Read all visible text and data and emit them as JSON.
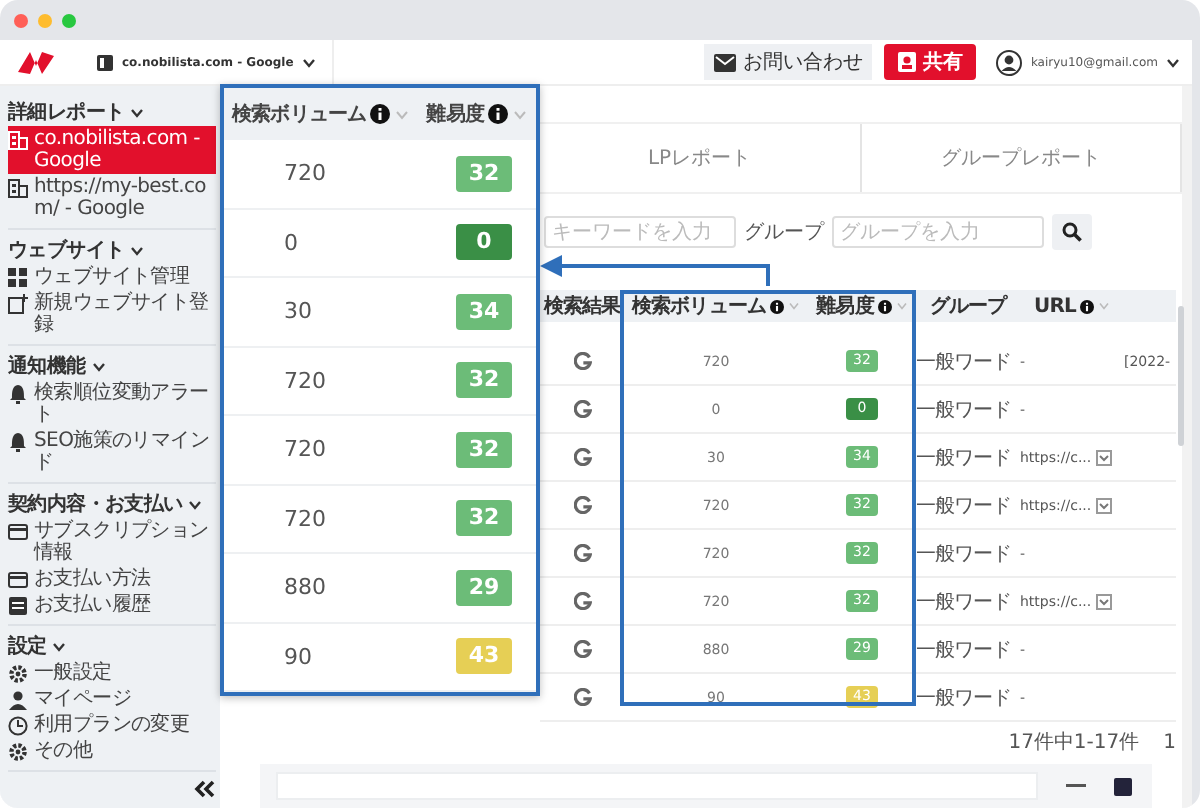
{
  "header": {
    "site_selector": "co.nobilista.com - Google",
    "contact_button": "お問い合わせ",
    "share_button": "共有",
    "account_email": "kairyu10@gmail.com"
  },
  "sidebar": {
    "sections": [
      {
        "title": "詳細レポート",
        "items": [
          {
            "label": "co.nobilista.com - Google",
            "selected": true
          },
          {
            "label": "https://my-best.com/ - Google",
            "selected": false
          }
        ]
      },
      {
        "title": "ウェブサイト",
        "items": [
          {
            "label": "ウェブサイト管理",
            "selected": false
          },
          {
            "label": "新規ウェブサイト登録",
            "selected": false
          }
        ]
      },
      {
        "title": "通知機能",
        "items": [
          {
            "label": "検索順位変動アラート",
            "selected": false
          },
          {
            "label": "SEO施策のリマインド",
            "selected": false
          }
        ]
      },
      {
        "title": "契約内容・お支払い",
        "items": [
          {
            "label": "サブスクリプション情報",
            "selected": false
          },
          {
            "label": "お支払い方法",
            "selected": false
          },
          {
            "label": "お支払い履歴",
            "selected": false
          }
        ]
      },
      {
        "title": "設定",
        "items": [
          {
            "label": "一般設定",
            "selected": false
          },
          {
            "label": "マイページ",
            "selected": false
          },
          {
            "label": "利用プランの変更",
            "selected": false
          },
          {
            "label": "その他",
            "selected": false
          }
        ]
      }
    ]
  },
  "tabs": [
    {
      "label": "LPレポート",
      "selected": false
    },
    {
      "label": "グループレポート",
      "selected": false
    }
  ],
  "filters": {
    "keyword_placeholder": "キーワードを入力",
    "group_label": "グループ",
    "group_placeholder": "グループを入力"
  },
  "table": {
    "columns": [
      "検索結果",
      "検索ボリューム",
      "難易度",
      "グループ",
      "URL"
    ],
    "rows": [
      {
        "volume": "720",
        "difficulty": "32",
        "color": "#6cbc78",
        "group": "一般ワード",
        "url": "-",
        "expandable": false,
        "column_6": "[2022-"
      },
      {
        "volume": "0",
        "difficulty": "0",
        "color": "#3a8f46",
        "group": "一般ワード",
        "url": "-",
        "expandable": false
      },
      {
        "volume": "30",
        "difficulty": "34",
        "color": "#6cbc78",
        "group": "一般ワード",
        "url": "https://c...",
        "expandable": true
      },
      {
        "volume": "720",
        "difficulty": "32",
        "color": "#6cbc78",
        "group": "一般ワード",
        "url": "https://c...",
        "expandable": true
      },
      {
        "volume": "720",
        "difficulty": "32",
        "color": "#6cbc78",
        "group": "一般ワード",
        "url": "-",
        "expandable": false
      },
      {
        "volume": "720",
        "difficulty": "32",
        "color": "#6cbc78",
        "group": "一般ワード",
        "url": "https://c...",
        "expandable": true
      },
      {
        "volume": "880",
        "difficulty": "29",
        "color": "#6cbc78",
        "group": "一般ワード",
        "url": "-",
        "expandable": false
      },
      {
        "volume": "90",
        "difficulty": "43",
        "color": "#e6cf55",
        "group": "一般ワード",
        "url": "-",
        "expandable": false
      }
    ]
  },
  "pagination": {
    "summary": "17件中1-17件",
    "page": "1"
  },
  "zoom_panel": {
    "columns": [
      "検索ボリューム",
      "難易度"
    ],
    "rows": [
      {
        "volume": "720",
        "difficulty": "32",
        "color": "#6cbc78"
      },
      {
        "volume": "0",
        "difficulty": "0",
        "color": "#3a8f46"
      },
      {
        "volume": "30",
        "difficulty": "34",
        "color": "#6cbc78"
      },
      {
        "volume": "720",
        "difficulty": "32",
        "color": "#6cbc78"
      },
      {
        "volume": "720",
        "difficulty": "32",
        "color": "#6cbc78"
      },
      {
        "volume": "720",
        "difficulty": "32",
        "color": "#6cbc78"
      },
      {
        "volume": "880",
        "difficulty": "29",
        "color": "#6cbc78"
      },
      {
        "volume": "90",
        "difficulty": "43",
        "color": "#e6cf55"
      }
    ]
  }
}
